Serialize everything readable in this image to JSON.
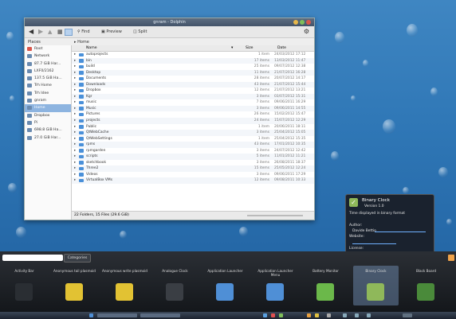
{
  "window": {
    "title": "gnram - Dolphin",
    "toolbar": {
      "find": "Find",
      "preview": "Preview",
      "split": "Split"
    },
    "places_label": "Places",
    "breadcrumb": "Home",
    "places": [
      "Root",
      "Network",
      "87.7 GiB Har...",
      "LXF0/2162",
      "137.5 GiB Ha...",
      "Trh Home",
      "Trh Idee",
      "gnram",
      "Home",
      "Dropbox",
      "Pi",
      "698.8 GiB Ha...",
      "27.0 GiB Har..."
    ],
    "columns": {
      "name": "Name",
      "size": "Size",
      "date": "Date"
    },
    "files": [
      {
        "name": "autoprojects",
        "size": "1 item",
        "date": "24/03/2012 17:12"
      },
      {
        "name": "bin",
        "size": "17 items",
        "date": "13/03/2012 11:47"
      },
      {
        "name": "build",
        "size": "25 items",
        "date": "09/07/2012 12:38"
      },
      {
        "name": "Desktop",
        "size": "11 items",
        "date": "21/07/2012 16:28"
      },
      {
        "name": "Documents",
        "size": "28 items",
        "date": "20/07/2012 14:17"
      },
      {
        "name": "Downloads",
        "size": "43 items",
        "date": "21/07/2012 15:44"
      },
      {
        "name": "Dropbox",
        "size": "12 items",
        "date": "21/07/2012 13:21"
      },
      {
        "name": "Kgr",
        "size": "3 items",
        "date": "03/07/2012 15:31"
      },
      {
        "name": "music",
        "size": "7 items",
        "date": "09/06/2011 16:29"
      },
      {
        "name": "Music",
        "size": "3 items",
        "date": "09/06/2011 14:55"
      },
      {
        "name": "Pictures",
        "size": "26 items",
        "date": "15/02/2012 15:47"
      },
      {
        "name": "projects",
        "size": "24 items",
        "date": "15/07/2012 12:29"
      },
      {
        "name": "Public",
        "size": "1 item",
        "date": "20/06/2011 18:11"
      },
      {
        "name": "QtWebCache",
        "size": "3 items",
        "date": "25/04/2012 15:05"
      },
      {
        "name": "QtWebSettings",
        "size": "1 item",
        "date": "25/04/2012 15:35"
      },
      {
        "name": "rpms",
        "size": "43 items",
        "date": "17/01/2012 10:35"
      },
      {
        "name": "rpmgarden",
        "size": "3 items",
        "date": "24/07/2012 12:42"
      },
      {
        "name": "scripts",
        "size": "5 items",
        "date": "11/01/2012 11:21"
      },
      {
        "name": "sketchbook",
        "size": "3 items",
        "date": "26/08/2011 18:37"
      },
      {
        "name": "Three2",
        "size": "15 items",
        "date": "25/05/2012 12:24"
      },
      {
        "name": "Videos",
        "size": "3 items",
        "date": "09/06/2011 17:29"
      },
      {
        "name": "VirtualBox VMs",
        "size": "12 items",
        "date": "09/08/2011 10:33"
      }
    ],
    "status": "22 Folders, 15 Files (29.6 GiB)"
  },
  "tooltip": {
    "title": "Binary Clock",
    "version": "Version 1.0",
    "description": "Time displayed in binary format",
    "author_label": "Author:",
    "author": "Davide Bettio",
    "website_label": "Website:",
    "license_label": "License:",
    "license": "GPL"
  },
  "explorer": {
    "categories_label": "Categories",
    "widgets": [
      {
        "label": "Activity Bar",
        "icon": "activity-bar-icon",
        "color": "#2a2e33"
      },
      {
        "label": "Anonymous tail plasmoid",
        "icon": "pencil-note-icon",
        "color": "#e2c233"
      },
      {
        "label": "Anonymous write plasmoid",
        "icon": "pencil-note-icon",
        "color": "#e2c233"
      },
      {
        "label": "Analogue Clock",
        "icon": "clock-icon",
        "color": "#3a3e44"
      },
      {
        "label": "Application Launcher",
        "icon": "kde-k-icon",
        "color": "#4f8fd6"
      },
      {
        "label": "Application Launcher Menu",
        "icon": "kde-k-icon",
        "color": "#4f8fd6"
      },
      {
        "label": "Battery Monitor",
        "icon": "battery-icon",
        "color": "#6bb84a"
      },
      {
        "label": "Binary Clock",
        "icon": "binary-clock-icon",
        "color": "#8fb85a"
      },
      {
        "label": "Black Board",
        "icon": "blackboard-icon",
        "color": "#4a8a3a"
      }
    ]
  }
}
